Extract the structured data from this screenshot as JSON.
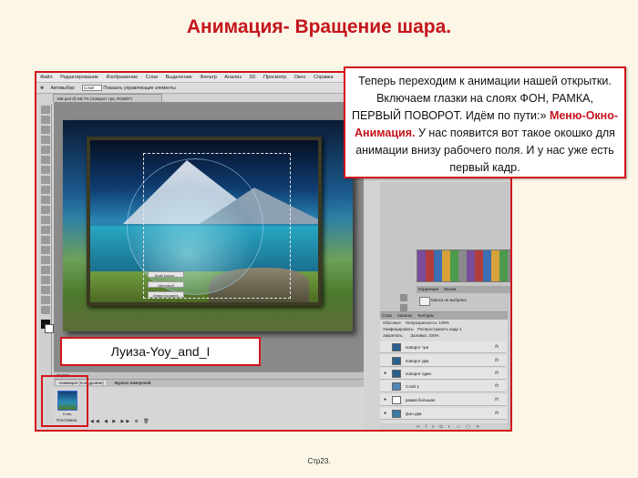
{
  "slide": {
    "title": "Анимация- Вращение шара.",
    "page_number": "Стр23."
  },
  "callout": {
    "text_before": "Теперь переходим к анимации нашей открытки. Включаем глазки на слоях ФОН, РАМКА, ПЕРВЫЙ ПОВОРОТ. Идём по пути:» ",
    "highlight": "Меню-Окно-Анимация.",
    "text_after": " У нас появится вот такое окошко для анимации внизу рабочего поля. И у нас уже есть первый кадр."
  },
  "signature": {
    "text": "Луиза-Yoy_and_I"
  },
  "photoshop": {
    "menu": [
      "Файл",
      "Редактирование",
      "Изображение",
      "Слои",
      "Выделение",
      "Фильтр",
      "Анализ",
      "3D",
      "Просмотр",
      "Окно",
      "Справка"
    ],
    "options": {
      "autoselect_label": "Автовыбор:",
      "autoselect_value": "Слой",
      "show_controls": "Показать управляющие элементы"
    },
    "document_tab": "168.psd @ 66,7% (поворот три, RGB/8*)",
    "status": {
      "zoom": "66,67%"
    },
    "animation_panel": {
      "tabs": [
        "Анимация (покадровая)",
        "Журнал измерений"
      ],
      "frame_time": "0 сек.",
      "loop": "Постоянно",
      "controls": "◀◀ ◀ ▶ ▶▶ ⊕ 🗑"
    },
    "adjustments": {
      "tabs": [
        "Коррекция",
        "Маски"
      ],
      "mask_label": "Маска не выбрана",
      "buttons": [
        "Край маски...",
        "Цветовой диапазон...",
        "Инвертировать"
      ]
    },
    "layers_panel": {
      "tabs": [
        "Слои",
        "Каналы",
        "Контуры"
      ],
      "blend_mode": "Обычные",
      "opacity_label": "Непрозрачность:",
      "opacity": "100%",
      "unify_label": "Унифицировать:",
      "propagate_label": "Распространить кадр 1",
      "lock_label": "Закрепить:",
      "fill_label": "Заливка:",
      "fill": "100%",
      "layers": [
        {
          "name": "поворот три",
          "fx": "fx"
        },
        {
          "name": "поворот два",
          "fx": "fx"
        },
        {
          "name": "поворот один",
          "fx": "fx"
        },
        {
          "name": "Слой 1",
          "fx": "fx"
        },
        {
          "name": "рамка большая",
          "fx": "fx"
        },
        {
          "name": "фон два",
          "fx": "fx"
        }
      ]
    }
  },
  "colors": {
    "title_red": "#c5141c",
    "border_red": "#d3141c",
    "slide_bg": "#fbf6e6"
  }
}
